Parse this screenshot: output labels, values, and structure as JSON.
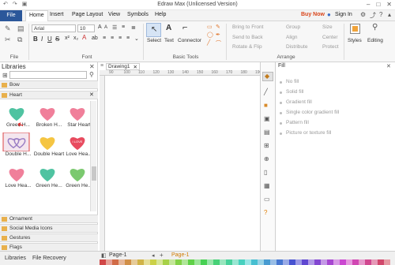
{
  "window": {
    "title": "Edraw Max (Unlicensed Version)",
    "minimize": "–",
    "maximize": "□",
    "close": "✕"
  },
  "menu": {
    "file": "File",
    "home": "Home",
    "insert": "Insert",
    "page_layout": "Page Layout",
    "view": "View",
    "symbols": "Symbols",
    "help": "Help",
    "buy_now": "Buy Now",
    "sign_in": "Sign In"
  },
  "ribbon": {
    "groups": {
      "file": "File",
      "font": "Font",
      "basic_tools": "Basic Tools",
      "arrange": "Arrange"
    },
    "font_name": "Arial",
    "font_size": "10",
    "select_label": "Select",
    "text_label": "Text",
    "connector_label": "Connector",
    "arrange": {
      "bring_to_front": "Bring to Front",
      "send_to_back": "Send to Back",
      "rotate_flip": "Rotate & Flip",
      "group": "Group",
      "align": "Align",
      "distribute": "Distribute",
      "size": "Size",
      "center": "Center",
      "protect": "Protect"
    },
    "styles_label": "Styles",
    "editing_label": "Editing"
  },
  "libraries": {
    "header": "Libraries",
    "categories": {
      "bow": "Bow",
      "heart": "Heart",
      "ornament": "Ornament",
      "social_media_icons": "Social Media Icons",
      "gestures": "Gestures",
      "flags": "Flags"
    },
    "shapes": [
      {
        "label": "Green H...",
        "color": "#4fc3a1"
      },
      {
        "label": "Broken H...",
        "color": "#f07f9a"
      },
      {
        "label": "Star Heart",
        "color": "#f07f9a"
      },
      {
        "label": "Double H...",
        "color": "#9b7fc4"
      },
      {
        "label": "Double Heart",
        "color": "#f5c542"
      },
      {
        "label": "Love Hea...",
        "color": "#e84b5f"
      },
      {
        "label": "Love Hea...",
        "color": "#f07f9a"
      },
      {
        "label": "Green He...",
        "color": "#4fc3a1"
      },
      {
        "label": "Green He...",
        "color": "#7bc96f"
      }
    ],
    "love_badge": "I LOVE"
  },
  "document": {
    "tab_name": "Drawing1",
    "ruler_ticks": [
      "90",
      "100",
      "110",
      "120",
      "130",
      "140",
      "150",
      "160",
      "170",
      "180",
      "190"
    ]
  },
  "fill_panel": {
    "header": "Fill",
    "options": [
      "No fill",
      "Solid fill",
      "Gradient fill",
      "Single color gradient fill",
      "Pattern fill",
      "Picture or texture fill"
    ]
  },
  "bottom": {
    "libraries_tab": "Libraries",
    "file_recovery_tab": "File Recovery",
    "page_tab": "Page-1",
    "page_tab_active": "Page-1"
  }
}
